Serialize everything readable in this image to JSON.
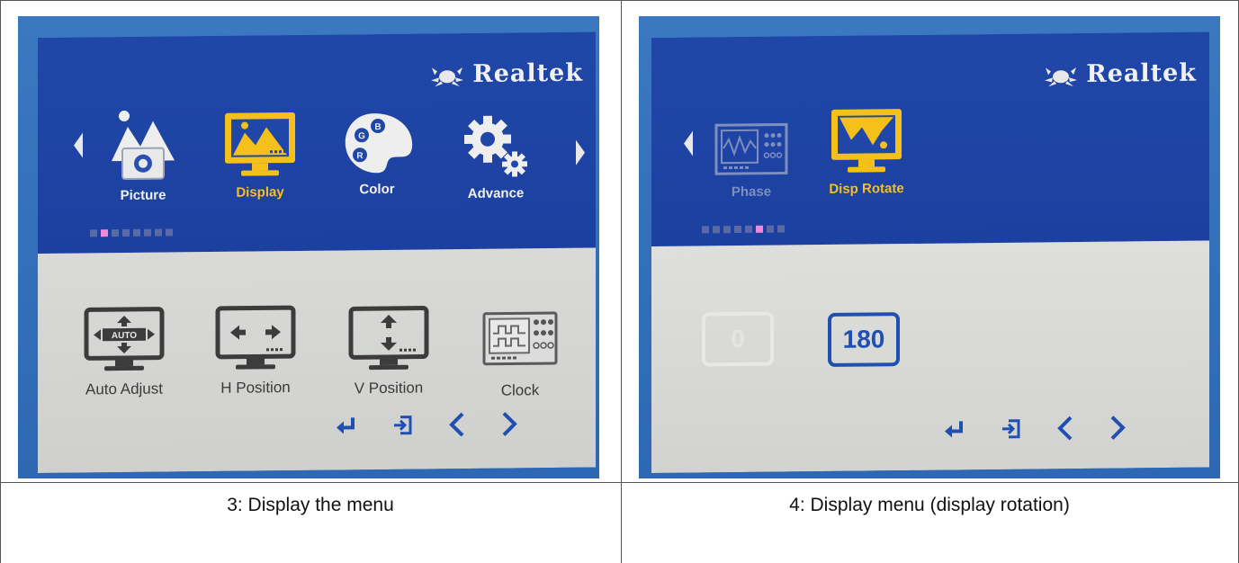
{
  "left_panel": {
    "brand": "Realtek",
    "menu_items": [
      {
        "label": "Picture",
        "icon": "picture-icon"
      },
      {
        "label": "Display",
        "icon": "display-icon"
      },
      {
        "label": "Color",
        "icon": "color-palette-icon"
      },
      {
        "label": "Advance",
        "icon": "advance-gear-icon"
      }
    ],
    "selected_menu": "Display",
    "page_indicator": {
      "count": 8,
      "active_index": 1
    },
    "sub_items": [
      {
        "label": "Auto Adjust",
        "icon": "auto-adjust-icon",
        "icon_text": "AUTO"
      },
      {
        "label": "H Position",
        "icon": "h-position-icon"
      },
      {
        "label": "V Position",
        "icon": "v-position-icon"
      },
      {
        "label": "Clock",
        "icon": "clock-icon"
      }
    ],
    "nav_icons": [
      "enter-icon",
      "exit-icon",
      "previous-icon",
      "next-icon"
    ],
    "caption": "3: Display the menu"
  },
  "right_panel": {
    "brand": "Realtek",
    "menu_items": [
      {
        "label": "Phase",
        "icon": "phase-icon"
      },
      {
        "label": "Disp Rotate",
        "icon": "disp-rotate-icon"
      }
    ],
    "selected_menu": "Disp Rotate",
    "page_indicator": {
      "count": 8,
      "active_index": 5
    },
    "options": [
      {
        "label": "0",
        "selected": false
      },
      {
        "label": "180",
        "selected": true
      }
    ],
    "nav_icons": [
      "enter-icon",
      "exit-icon",
      "previous-icon",
      "next-icon"
    ],
    "caption": "4: Display menu (display rotation)"
  },
  "colors": {
    "osd_blue": "#1c40a0",
    "osd_gray": "#d4d5d2",
    "selected_yellow": "#f6c01a",
    "indicator_pink": "#f08ad8",
    "nav_blue": "#1f4fb0"
  }
}
